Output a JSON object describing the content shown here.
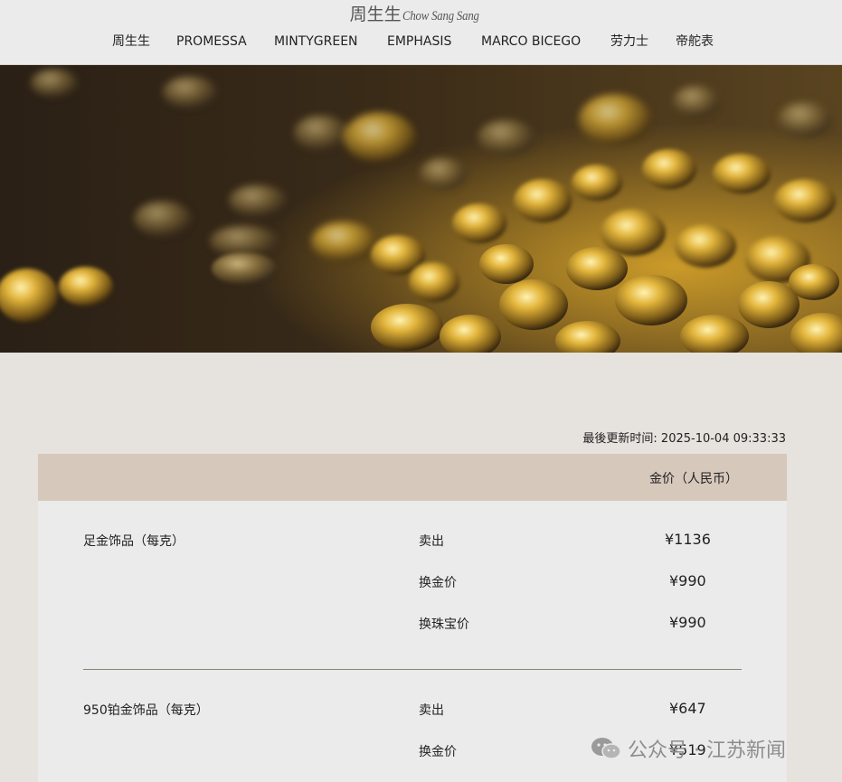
{
  "header": {
    "logo_cn": "周生生",
    "logo_en": "Chow Sang Sang",
    "nav": [
      "周生生",
      "PROMESSA",
      "MINTYGREEN",
      "EMPHASIS",
      "MARCO BICEGO",
      "劳力士",
      "帝舵表"
    ]
  },
  "update": {
    "label": "最後更新时间:",
    "datetime": "2025-10-04 09:33:33"
  },
  "table": {
    "column_header": "金价（人民币）",
    "rows": [
      {
        "product": "足金饰品（每克）",
        "prices": [
          {
            "type": "卖出",
            "value": "¥1136"
          },
          {
            "type": "换金价",
            "value": "¥990"
          },
          {
            "type": "换珠宝价",
            "value": "¥990"
          }
        ]
      },
      {
        "product": "950铂金饰品（每克）",
        "prices": [
          {
            "type": "卖出",
            "value": "¥647"
          },
          {
            "type": "换金价",
            "value": "¥519"
          }
        ]
      }
    ]
  },
  "watermark": {
    "text": "公众号 · 江苏新闻",
    "icon": "wechat-icon"
  },
  "colors": {
    "header_bg": "#ebebeb",
    "page_bg": "#e6e2dd",
    "table_header_bg": "#d7c8bc",
    "table_body_bg": "#ebebeb"
  }
}
